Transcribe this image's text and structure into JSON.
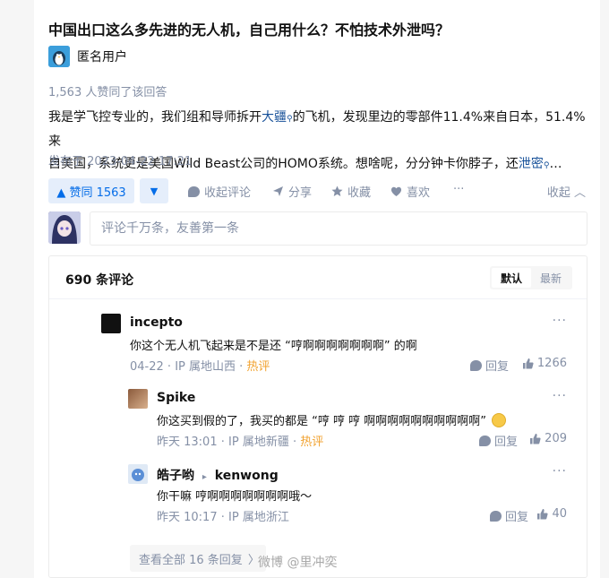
{
  "question": {
    "title": "中国出口这么多先进的无人机，自己用什么？不怕技术外泄吗？"
  },
  "author": {
    "name": "匿名用户",
    "avatar_icon": "anonymous-penguin-icon"
  },
  "answer": {
    "upvote_summary": "1,563 人赞同了该回答",
    "body_line1_pre": "我是学飞控专业的，我们组和导师拆开",
    "body_keyword1": "大疆",
    "body_line1_post": "的飞机，发现里边的零部件11.4%来自日本，51.4%来",
    "body_line2_pre": "自美国，系统更是美国Wild Beast公司的HOMO系统。想啥呢，分分钟卡你脖子，还",
    "body_keyword2": "泄密",
    "body_line2_post": "…",
    "published": "发布于 2023-04-22 17:21"
  },
  "actions": {
    "upvote": "▲ 赞同 1563",
    "downvote": "▼",
    "collapse_comments": "收起评论",
    "share": "分享",
    "favorite": "收藏",
    "like": "喜欢",
    "more": "···",
    "collapse": "收起 ︿"
  },
  "comment_input": {
    "placeholder": "评论千万条，友善第一条"
  },
  "comments": {
    "count_label": "690 条评论",
    "sort_default": "默认",
    "sort_latest": "最新",
    "items": [
      {
        "name": "incepto",
        "text": "你这个无人机飞起来是不是还 “哼啊啊啊啊啊啊啊” 的啊",
        "date": "04-22",
        "ip": "IP 属地山西",
        "hot": "热评",
        "reply": "回复",
        "likes": "1266",
        "more": "···"
      },
      {
        "name": "Spike",
        "text": "你这买到假的了，我买的都是 “哼 哼 哼 啊啊啊啊啊啊啊啊啊啊”",
        "date": "昨天 13:01",
        "ip": "IP 属地新疆",
        "hot": "热评",
        "reply": "回复",
        "likes": "209",
        "more": "···"
      },
      {
        "name": "皓子哟",
        "reply_to": "kenwong",
        "reply_arrow": "▸",
        "text": "你干嘛 哼啊啊啊啊啊啊啊哦～",
        "date": "昨天 10:17",
        "ip": "IP 属地浙江",
        "reply": "回复",
        "likes": "40",
        "more": "···"
      }
    ],
    "view_all": "查看全部 16 条回复",
    "view_all_arrow": "〉"
  },
  "watermark": "微博 @里冲奕",
  "colors": {
    "accent": "#056de8",
    "hot": "#f1a22f",
    "muted": "#8590a6"
  }
}
